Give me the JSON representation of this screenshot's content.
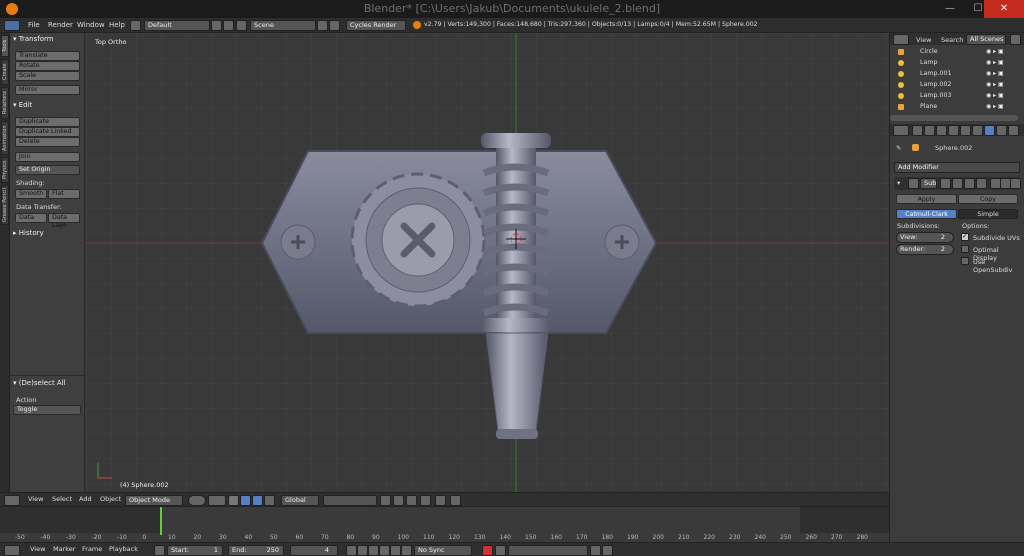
{
  "window": {
    "title": "Blender* [C:\\Users\\Jakub\\Documents\\ukulele_2.blend]",
    "minimize": "—",
    "maximize": "☐",
    "close": "✕"
  },
  "info": {
    "menus": [
      "File",
      "Render",
      "Window",
      "Help"
    ],
    "layout": "Default",
    "scene": "Scene",
    "engine": "Cycles Render",
    "stats": "v2.79 | Verts:149,300 | Faces:148,680 | Tris:297,360 | Objects:0/13 | Lamps:0/4 | Mem:52.65M | Sphere.002"
  },
  "tool_tabs": [
    "Tools",
    "Create",
    "Relations",
    "Animation",
    "Physics",
    "Grease Pencil"
  ],
  "tools": {
    "transform_header": "Transform",
    "translate": "Translate",
    "rotate": "Rotate",
    "scale": "Scale",
    "mirror": "Mirror",
    "edit_header": "Edit",
    "duplicate": "Duplicate",
    "duplicate_linked": "Duplicate Linked",
    "delete": "Delete",
    "join": "Join",
    "set_origin": "Set Origin",
    "shading_label": "Shading:",
    "smooth": "Smooth",
    "flat": "Flat",
    "data_transfer_label": "Data Transfer:",
    "data": "Data",
    "data_layo": "Data Layo",
    "history_header": "History",
    "deselect_header": "(De)select All",
    "action_label": "Action",
    "action_value": "Toggle"
  },
  "viewport": {
    "view_label": "Top Ortho",
    "object_label": "(4) Sphere.002"
  },
  "outliner": {
    "view": "View",
    "search": "Search",
    "scenes": "All Scenes",
    "objects": [
      {
        "name": "Circle",
        "icon": "mesh"
      },
      {
        "name": "Lamp",
        "icon": "lamp"
      },
      {
        "name": "Lamp.001",
        "icon": "lamp"
      },
      {
        "name": "Lamp.002",
        "icon": "lamp"
      },
      {
        "name": "Lamp.003",
        "icon": "lamp"
      },
      {
        "name": "Plane",
        "icon": "mesh"
      }
    ]
  },
  "properties": {
    "object_name": "Sphere.002",
    "add_modifier": "Add Modifier",
    "modifier_name": "Sub",
    "apply": "Apply",
    "copy": "Copy",
    "catmull": "Catmull-Clark",
    "simple": "Simple",
    "subdivisions_label": "Subdivisions:",
    "options_label": "Options:",
    "view_label": "View:",
    "view_value": "2",
    "render_label": "Render:",
    "render_value": "2",
    "subdivide_uvs": "Subdivide UVs",
    "optimal_display": "Optimal Display",
    "use_opensubdiv": "Use OpenSubdiv",
    "subdivide_uvs_checked": true,
    "optimal_display_checked": false,
    "use_opensubdiv_checked": false
  },
  "view3d_header": {
    "view": "View",
    "select": "Select",
    "add": "Add",
    "object": "Object",
    "mode": "Object Mode",
    "orientation": "Global"
  },
  "timeline": {
    "ruler": [
      "-50",
      "-40",
      "-30",
      "-20",
      "-10",
      "0",
      "10",
      "20",
      "30",
      "40",
      "50",
      "60",
      "70",
      "80",
      "90",
      "100",
      "110",
      "120",
      "130",
      "140",
      "150",
      "160",
      "170",
      "180",
      "190",
      "200",
      "210",
      "220",
      "230",
      "240",
      "250",
      "260",
      "270",
      "280"
    ],
    "current_frame": 4
  },
  "tl_header": {
    "view": "View",
    "marker": "Marker",
    "frame": "Frame",
    "playback": "Playback",
    "start_label": "Start:",
    "start": "1",
    "end_label": "End:",
    "end": "250",
    "current": "4",
    "sync": "No Sync"
  }
}
